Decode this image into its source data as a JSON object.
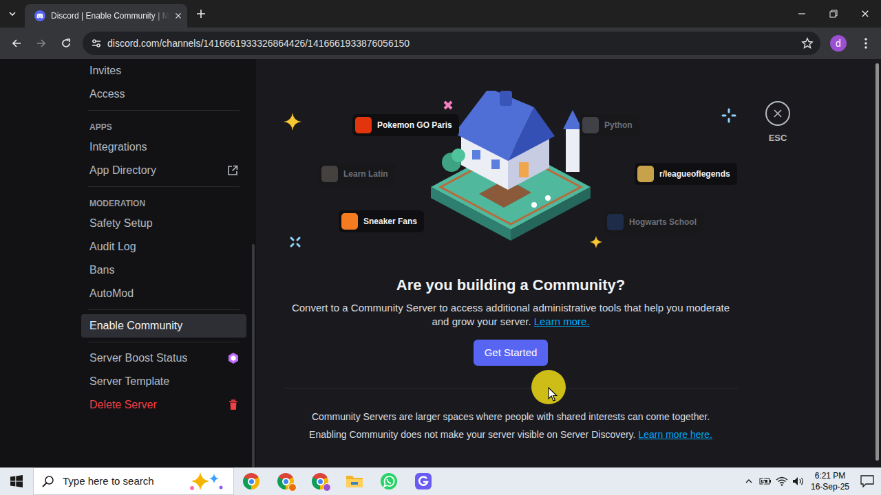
{
  "window": {
    "title": "Discord | Enable Community | M"
  },
  "tabs": [
    {
      "label": "Discord | Enable Community | M",
      "selected": true
    }
  ],
  "address": {
    "url": "discord.com/channels/1416661933326864426/1416661933876056150",
    "bookmarked": false
  },
  "profile": {
    "initial": "d"
  },
  "sidebar": {
    "groups": [
      {
        "items": [
          {
            "label": "Invites",
            "selected": false,
            "kind": "plain"
          },
          {
            "label": "Access",
            "selected": false,
            "kind": "plain"
          }
        ]
      },
      {
        "header": "APPS",
        "items": [
          {
            "label": "Integrations",
            "selected": false,
            "kind": "plain"
          },
          {
            "label": "App Directory",
            "selected": false,
            "kind": "external"
          }
        ]
      },
      {
        "header": "MODERATION",
        "items": [
          {
            "label": "Safety Setup",
            "selected": false,
            "kind": "plain"
          },
          {
            "label": "Audit Log",
            "selected": false,
            "kind": "plain"
          },
          {
            "label": "Bans",
            "selected": false,
            "kind": "plain"
          },
          {
            "label": "AutoMod",
            "selected": false,
            "kind": "plain"
          }
        ]
      },
      {
        "items": [
          {
            "label": "Enable Community",
            "selected": true,
            "kind": "plain"
          }
        ]
      },
      {
        "items": [
          {
            "label": "Server Boost Status",
            "selected": false,
            "kind": "boost"
          },
          {
            "label": "Server Template",
            "selected": false,
            "kind": "plain"
          },
          {
            "label": "Delete Server",
            "selected": false,
            "kind": "danger"
          }
        ]
      }
    ]
  },
  "illustration": {
    "servers": [
      {
        "name": "Pokemon GO Paris",
        "faded": false,
        "color": "#e3350d"
      },
      {
        "name": "Python",
        "faded": true,
        "color": "#8a8f99"
      },
      {
        "name": "Learn Latin",
        "faded": true,
        "color": "#9a8f80"
      },
      {
        "name": "r/leagueoflegends",
        "faded": false,
        "color": "#c8a24a"
      },
      {
        "name": "Sneaker Fans",
        "faded": false,
        "color": "#f47b20"
      },
      {
        "name": "Hogwarts School",
        "faded": true,
        "color": "#2a4fa0"
      }
    ]
  },
  "close": {
    "label": "ESC"
  },
  "hero": {
    "title": "Are you building a Community?",
    "text": "Convert to a Community Server to access additional administrative tools that help you moderate and grow your server.",
    "link": "Learn more.",
    "button": "Get Started"
  },
  "footer": {
    "line1": "Community Servers are larger spaces where people with shared interests can come together.",
    "line2": "Enabling Community does not make your server visible on Server Discovery.",
    "link": "Learn more here."
  },
  "taskbar": {
    "search": {
      "placeholder": "Type here to search"
    },
    "apps": [
      {
        "kind": "chrome"
      },
      {
        "kind": "chrome-n"
      },
      {
        "kind": "chrome-profile"
      },
      {
        "kind": "explorer"
      },
      {
        "kind": "whatsapp"
      },
      {
        "kind": "gapp"
      }
    ],
    "clock": {
      "time": "6:21 PM",
      "date": "16-Sep-25"
    }
  },
  "pointer": {
    "highlighted": true
  }
}
